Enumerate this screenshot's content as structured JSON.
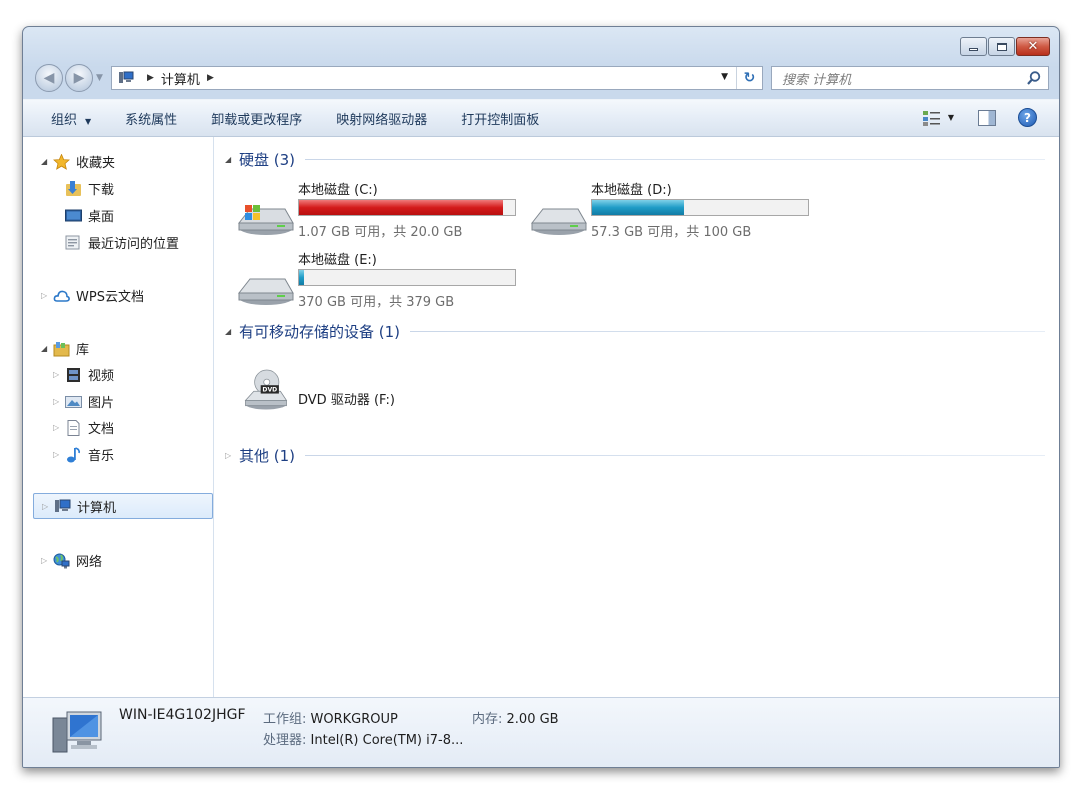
{
  "window": {
    "caption": {
      "minimize_icon": "minimize-icon",
      "maximize_icon": "maximize-icon",
      "close_glyph": "✕"
    }
  },
  "address": {
    "location": "计算机",
    "back_glyph": "◀",
    "forward_glyph": "▶",
    "refresh_glyph": "↻",
    "search_placeholder": "搜索 计算机"
  },
  "toolbar": {
    "organize": "组织",
    "system_properties": "系统属性",
    "uninstall": "卸载或更改程序",
    "map_drive": "映射网络驱动器",
    "control_panel": "打开控制面板",
    "help_glyph": "?"
  },
  "nav": {
    "favorites": "收藏夹",
    "downloads": "下载",
    "desktop": "桌面",
    "recent": "最近访问的位置",
    "wps": "WPS云文档",
    "libraries": "库",
    "videos": "视频",
    "pictures": "图片",
    "documents": "文档",
    "music": "音乐",
    "computer": "计算机",
    "network": "网络"
  },
  "groups": {
    "hard_disks": "硬盘 (3)",
    "removable": "有可移动存储的设备 (1)",
    "other": "其他 (1)"
  },
  "drives": [
    {
      "name": "本地磁盘 (C:)",
      "info": "1.07 GB 可用，共 20.0 GB",
      "used_fraction": 0.946,
      "color": "#d41b1b"
    },
    {
      "name": "本地磁盘 (D:)",
      "info": "57.3 GB 可用，共 100 GB",
      "used_fraction": 0.427,
      "color": "#1f9cc7"
    },
    {
      "name": "本地磁盘 (E:)",
      "info": "370 GB 可用，共 379 GB",
      "used_fraction": 0.024,
      "color": "#1f9cc7"
    }
  ],
  "dvd": {
    "name": "DVD 驱动器 (F:)",
    "icon_text": "DVD"
  },
  "details": {
    "computer_name": "WIN-IE4G102JHGF",
    "workgroup_label": "工作组:",
    "workgroup": "WORKGROUP",
    "memory_label": "内存:",
    "memory": "2.00 GB",
    "processor_label": "处理器:",
    "processor": "Intel(R) Core(TM) i7-8..."
  }
}
